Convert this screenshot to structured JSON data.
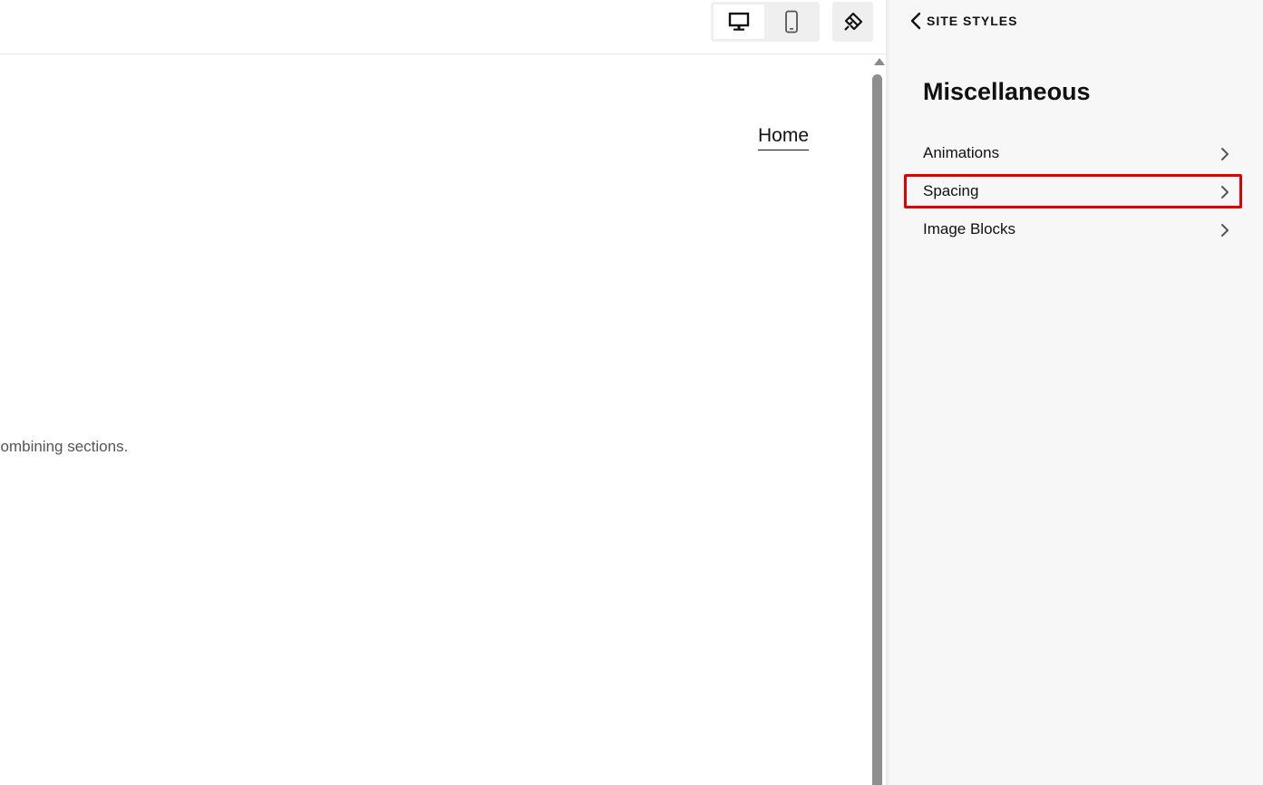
{
  "toolbar": {
    "desktop_icon": "desktop-icon",
    "mobile_icon": "mobile-icon",
    "paint_icon": "paint-brush-icon"
  },
  "preview": {
    "nav_home": "Home",
    "body_text": "combining sections."
  },
  "panel": {
    "back_label": "SITE STYLES",
    "title": "Miscellaneous",
    "items": [
      {
        "label": "Animations"
      },
      {
        "label": "Spacing"
      },
      {
        "label": "Image Blocks"
      }
    ]
  },
  "colors": {
    "highlight": "#e00000",
    "panel_bg": "#f7f7f7",
    "scrollbar": "#8f8f8f"
  }
}
